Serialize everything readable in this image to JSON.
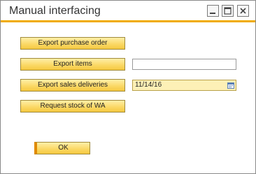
{
  "window": {
    "title": "Manual interfacing"
  },
  "buttons": {
    "export_purchase_order": "Export purchase order",
    "export_items": "Export items",
    "export_sales_deliveries": "Export sales deliveries",
    "request_stock": "Request stock of WA",
    "ok": "OK"
  },
  "fields": {
    "items_value": "",
    "sales_date_value": "11/14/16"
  },
  "icons": {
    "minimize": "minimize-icon",
    "maximize": "maximize-icon",
    "close": "close-icon",
    "calendar": "calendar-icon"
  },
  "colors": {
    "accent": "#f0ab00",
    "button_fill": "#fbd968",
    "date_field_fill": "#fdf0b6"
  }
}
